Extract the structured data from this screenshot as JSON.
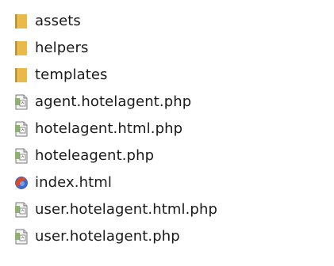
{
  "files": [
    {
      "name": "assets",
      "icon": "folder-icon",
      "type": "folder"
    },
    {
      "name": "helpers",
      "icon": "folder-icon",
      "type": "folder"
    },
    {
      "name": "templates",
      "icon": "folder-icon",
      "type": "folder"
    },
    {
      "name": "agent.hotelagent.php",
      "icon": "php-file-icon",
      "type": "file"
    },
    {
      "name": "hotelagent.html.php",
      "icon": "php-file-icon",
      "type": "file"
    },
    {
      "name": "hoteleagent.php",
      "icon": "php-file-icon",
      "type": "file"
    },
    {
      "name": "index.html",
      "icon": "html-file-icon",
      "type": "file"
    },
    {
      "name": "user.hotelagent.html.php",
      "icon": "php-file-icon",
      "type": "file"
    },
    {
      "name": "user.hotelagent.php",
      "icon": "php-file-icon",
      "type": "file"
    }
  ],
  "colors": {
    "folder": "#e9b949",
    "folder_dark": "#c8922b",
    "php_green": "#8bb36a",
    "php_gray": "#7a7a7a",
    "html_red": "#d84b2a",
    "html_blue": "#3a6bd1"
  }
}
